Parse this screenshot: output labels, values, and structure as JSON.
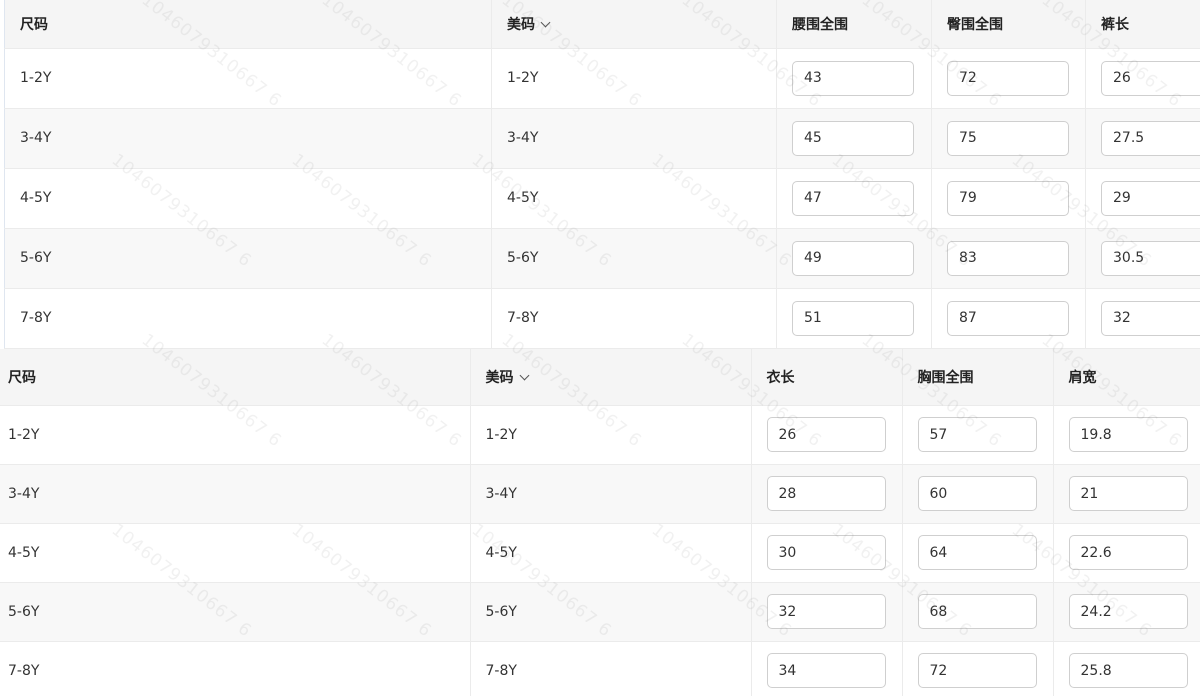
{
  "watermark": "1046079310667 6",
  "bottoms_table": {
    "headers": {
      "size": "尺码",
      "us_size": "美码",
      "waist": "腰围全围",
      "hip": "臀围全围",
      "pants_length": "裤长"
    },
    "rows": [
      {
        "size": "1-2Y",
        "us_size": "1-2Y",
        "waist": "43",
        "hip": "72",
        "pants_length": "26"
      },
      {
        "size": "3-4Y",
        "us_size": "3-4Y",
        "waist": "45",
        "hip": "75",
        "pants_length": "27.5"
      },
      {
        "size": "4-5Y",
        "us_size": "4-5Y",
        "waist": "47",
        "hip": "79",
        "pants_length": "29"
      },
      {
        "size": "5-6Y",
        "us_size": "5-6Y",
        "waist": "49",
        "hip": "83",
        "pants_length": "30.5"
      },
      {
        "size": "7-8Y",
        "us_size": "7-8Y",
        "waist": "51",
        "hip": "87",
        "pants_length": "32"
      }
    ]
  },
  "tops_table": {
    "headers": {
      "size": "尺码",
      "us_size": "美码",
      "top_length": "衣长",
      "chest": "胸围全围",
      "shoulder": "肩宽"
    },
    "rows": [
      {
        "size": "1-2Y",
        "us_size": "1-2Y",
        "top_length": "26",
        "chest": "57",
        "shoulder": "19.8"
      },
      {
        "size": "3-4Y",
        "us_size": "3-4Y",
        "top_length": "28",
        "chest": "60",
        "shoulder": "21"
      },
      {
        "size": "4-5Y",
        "us_size": "4-5Y",
        "top_length": "30",
        "chest": "64",
        "shoulder": "22.6"
      },
      {
        "size": "5-6Y",
        "us_size": "5-6Y",
        "top_length": "32",
        "chest": "68",
        "shoulder": "24.2"
      },
      {
        "size": "7-8Y",
        "us_size": "7-8Y",
        "top_length": "34",
        "chest": "72",
        "shoulder": "25.8"
      }
    ]
  },
  "colors": {
    "header_bg": "#f5f5f5",
    "stripe_bg": "#f8f8f8",
    "border": "#ebebeb",
    "input_border": "#cfcfcf"
  }
}
